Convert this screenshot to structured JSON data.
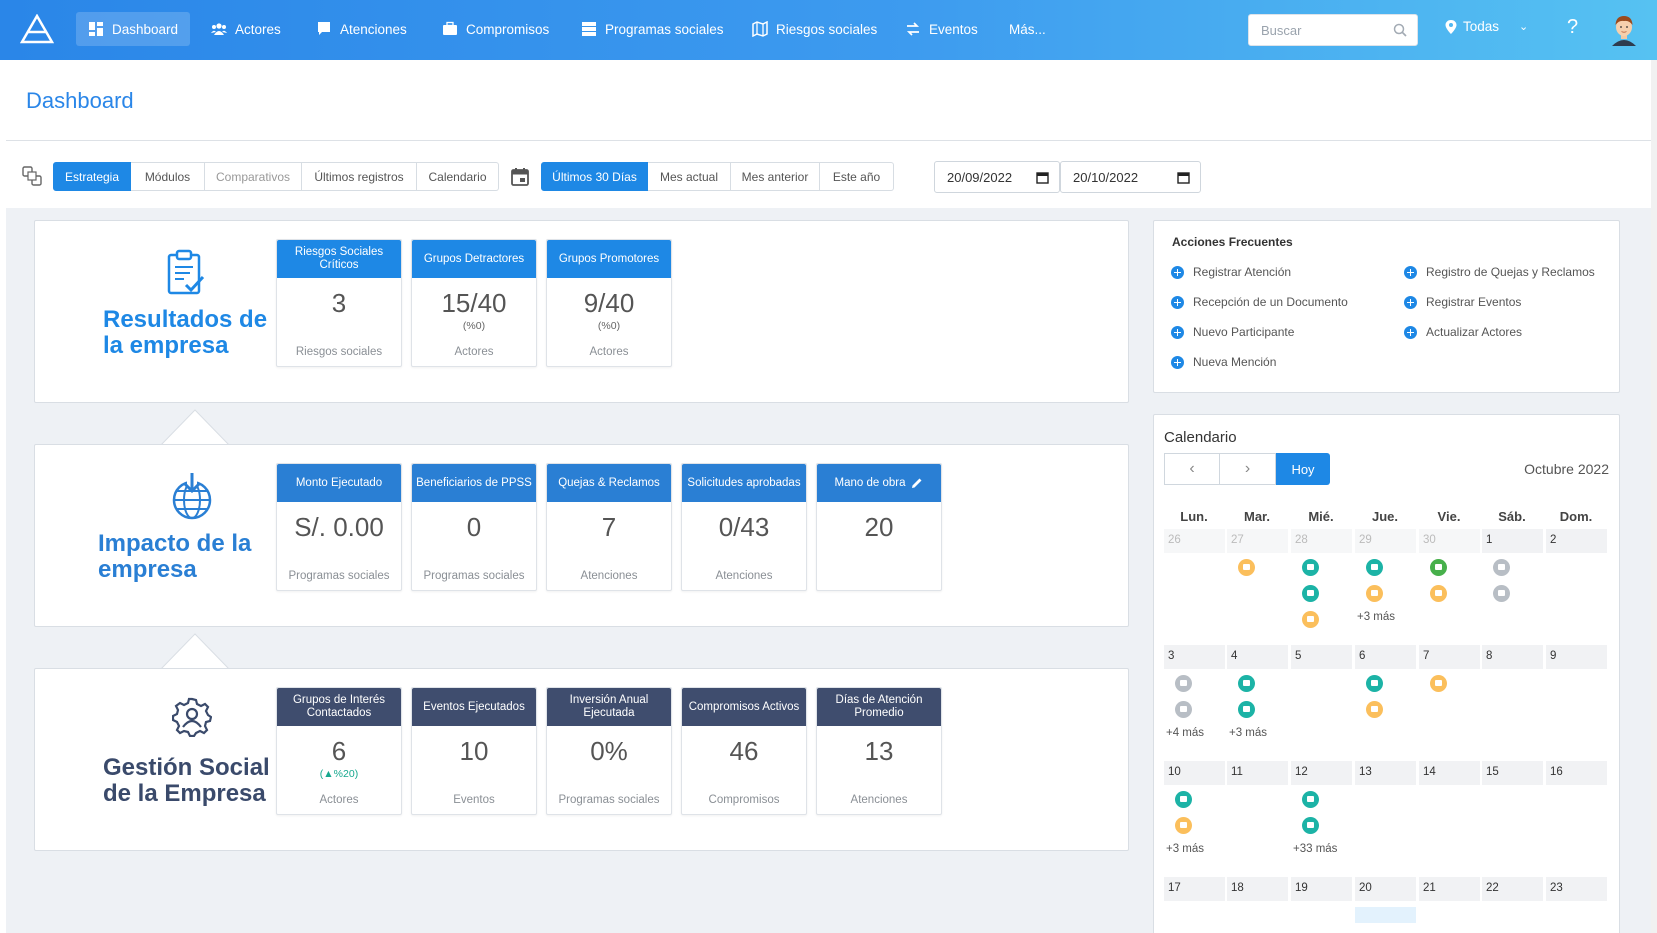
{
  "nav": {
    "items": [
      {
        "label": "Dashboard",
        "icon": "dashboard-icon",
        "active": true
      },
      {
        "label": "Actores",
        "icon": "users-icon"
      },
      {
        "label": "Atenciones",
        "icon": "chat-icon"
      },
      {
        "label": "Compromisos",
        "icon": "briefcase-icon"
      },
      {
        "label": "Programas sociales",
        "icon": "server-icon"
      },
      {
        "label": "Riesgos sociales",
        "icon": "map-icon"
      },
      {
        "label": "Eventos",
        "icon": "exchange-icon"
      },
      {
        "label": "Más..."
      }
    ],
    "search_placeholder": "Buscar",
    "location": "Todas",
    "help": "?"
  },
  "page_title": "Dashboard",
  "toolbar": {
    "views": [
      "Estrategia",
      "Módulos",
      "Comparativos",
      "Últimos registros",
      "Calendario"
    ],
    "active_view": "Estrategia",
    "ranges": [
      "Últimos 30 Días",
      "Mes actual",
      "Mes anterior",
      "Este año"
    ],
    "active_range": "Últimos 30 Días",
    "date_from": "20/09/2022",
    "date_to": "20/10/2022"
  },
  "sections": [
    {
      "title": "Resultados de la empresa",
      "color": "#1e88e5",
      "icon": "clipboard-check-icon",
      "header_color": "#1e88e5",
      "cards": [
        {
          "head": "Riesgos Sociales Críticos",
          "value": "3",
          "sub": "",
          "foot": "Riesgos sociales"
        },
        {
          "head": "Grupos Detractores",
          "value": "15/40",
          "sub": "(%0)",
          "foot": "Actores"
        },
        {
          "head": "Grupos Promotores",
          "value": "9/40",
          "sub": "(%0)",
          "foot": "Actores"
        }
      ]
    },
    {
      "title": "Impacto de la empresa",
      "color": "#2a7fd4",
      "icon": "globe-download-icon",
      "header_color": "#2a7fd4",
      "cards": [
        {
          "head": "Monto Ejecutado",
          "value": "S/. 0.00",
          "sub": "",
          "foot": "Programas sociales"
        },
        {
          "head": "Beneficiarios de PPSS",
          "value": "0",
          "sub": "",
          "foot": "Programas sociales"
        },
        {
          "head": "Quejas & Reclamos",
          "value": "7",
          "sub": "",
          "foot": "Atenciones"
        },
        {
          "head": "Solicitudes aprobadas",
          "value": "0/43",
          "sub": "",
          "foot": "Atenciones"
        },
        {
          "head": "Mano de obra",
          "value": "20",
          "sub": "",
          "foot": "",
          "editable": true
        }
      ]
    },
    {
      "title": "Gestión Social de la Empresa",
      "color": "#3a4a6b",
      "icon": "gear-user-icon",
      "header_color": "#3f4d6e",
      "cards": [
        {
          "head": "Grupos de Interés Contactados",
          "value": "6",
          "sub": "(▲%20)",
          "sub_green": true,
          "foot": "Actores"
        },
        {
          "head": "Eventos Ejecutados",
          "value": "10",
          "sub": "",
          "foot": "Eventos"
        },
        {
          "head": "Inversión Anual Ejecutada",
          "value": "0%",
          "sub": "",
          "foot": "Programas sociales"
        },
        {
          "head": "Compromisos Activos",
          "value": "46",
          "sub": "",
          "foot": "Compromisos"
        },
        {
          "head": "Días de Atención Promedio",
          "value": "13",
          "sub": "",
          "foot": "Atenciones"
        }
      ]
    }
  ],
  "quick_actions": {
    "title": "Acciones Frecuentes",
    "left": [
      "Registrar Atención",
      "Recepción de un Documento",
      "Nuevo Participante",
      "Nueva Mención"
    ],
    "right": [
      "Registro de Quejas y Reclamos",
      "Registrar Eventos",
      "Actualizar Actores"
    ]
  },
  "calendar": {
    "title": "Calendario",
    "today_label": "Hoy",
    "month": "Octubre 2022",
    "weekdays": [
      "Lun.",
      "Mar.",
      "Mié.",
      "Jue.",
      "Vie.",
      "Sáb.",
      "Dom."
    ],
    "weeks": [
      {
        "days": [
          "26",
          "27",
          "28",
          "29",
          "30",
          "1",
          "2"
        ],
        "other": [
          0,
          1,
          2,
          3,
          4
        ],
        "events": [
          [],
          [
            "orange"
          ],
          [
            "teal",
            "teal",
            "orange"
          ],
          [
            "teal",
            "orange"
          ],
          [
            "green",
            "orange"
          ],
          [
            "gray",
            "gray"
          ],
          []
        ],
        "more": [
          "",
          "",
          "",
          "+3 más",
          "",
          "",
          ""
        ]
      },
      {
        "days": [
          "3",
          "4",
          "5",
          "6",
          "7",
          "8",
          "9"
        ],
        "other": [],
        "events": [
          [
            "gray",
            "gray"
          ],
          [
            "teal",
            "teal"
          ],
          [],
          [
            "teal",
            "orange"
          ],
          [
            "orange"
          ],
          [],
          []
        ],
        "more": [
          "+4 más",
          "+3 más",
          "",
          "",
          "",
          "",
          ""
        ]
      },
      {
        "days": [
          "10",
          "11",
          "12",
          "13",
          "14",
          "15",
          "16"
        ],
        "other": [],
        "events": [
          [
            "teal",
            "orange"
          ],
          [],
          [
            "teal",
            "teal"
          ],
          [],
          [],
          [],
          []
        ],
        "more": [
          "+3 más",
          "",
          "+33 más",
          "",
          "",
          "",
          ""
        ]
      },
      {
        "days": [
          "17",
          "18",
          "19",
          "20",
          "21",
          "22",
          "23"
        ],
        "other": [],
        "events": [
          [],
          [],
          [],
          [],
          [],
          [],
          []
        ],
        "more": [
          "",
          "",
          "",
          "",
          "",
          "",
          ""
        ]
      }
    ]
  }
}
